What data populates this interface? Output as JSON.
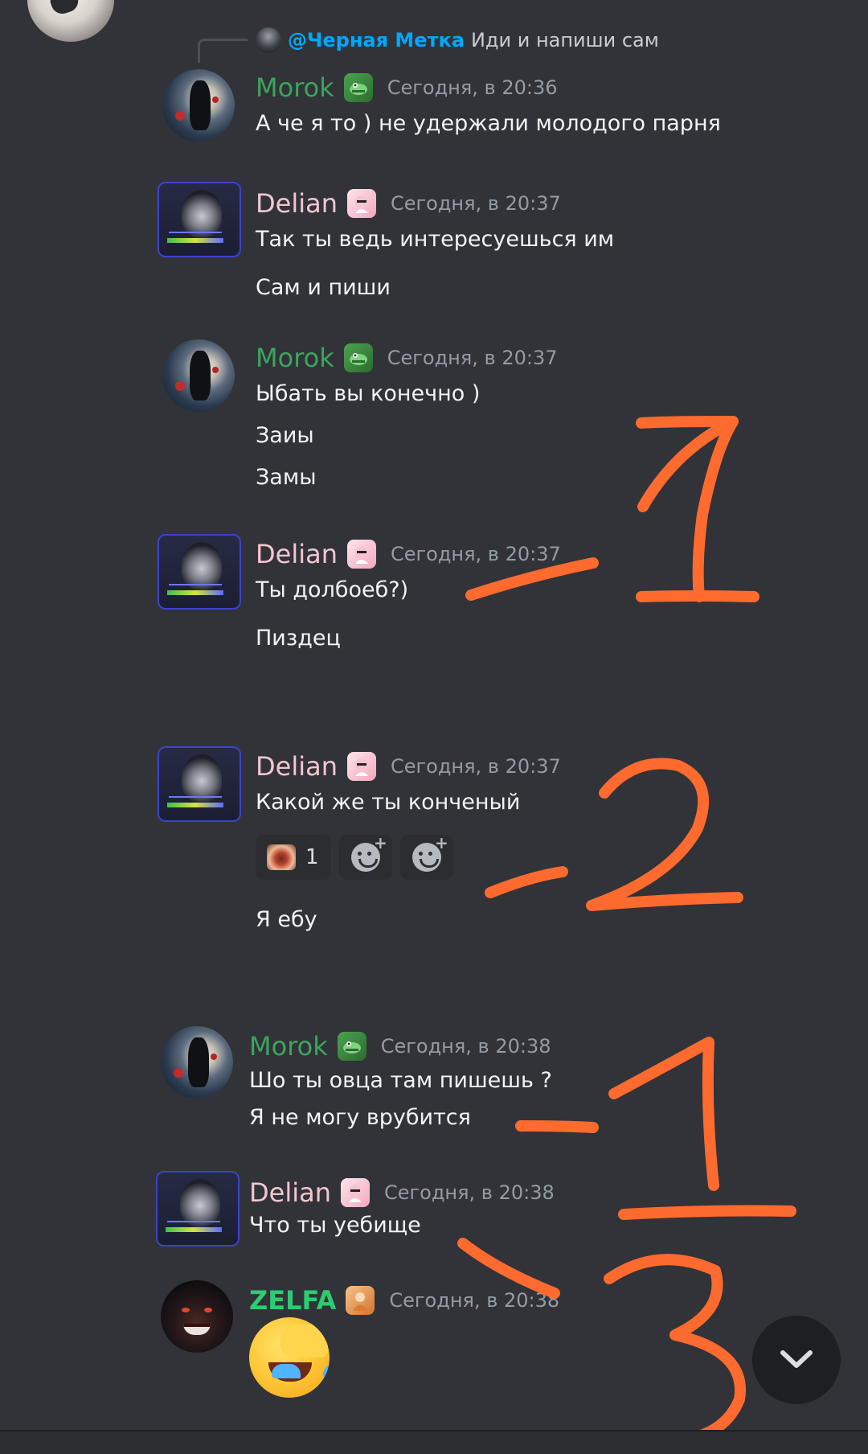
{
  "reply": {
    "mention": "@Черная Метка",
    "text": "Иди и напиши сам"
  },
  "messages": [
    {
      "user": "Morok",
      "role_icon": "crocodile-icon",
      "timestamp": "Сегодня, в 20:36",
      "lines": [
        "А че я то ) не удержали молодого парня"
      ]
    },
    {
      "user": "Delian",
      "role_icon": "pink-character-icon",
      "timestamp": "Сегодня, в 20:37",
      "lines": [
        "Так ты ведь интересуешься им",
        "Сам и пиши"
      ]
    },
    {
      "user": "Morok",
      "role_icon": "crocodile-icon",
      "timestamp": "Сегодня, в 20:37",
      "lines": [
        "Ыбать вы конечно )",
        "Заиы",
        "Замы"
      ]
    },
    {
      "user": "Delian",
      "role_icon": "pink-character-icon",
      "timestamp": "Сегодня, в 20:37",
      "lines": [
        "Ты долбоеб?)",
        "Пиздец"
      ]
    },
    {
      "user": "Delian",
      "role_icon": "pink-character-icon",
      "timestamp": "Сегодня, в 20:37",
      "lines": [
        "Какой же ты конченый",
        "Я ебу"
      ],
      "reaction_count": "1"
    },
    {
      "user": "Morok",
      "role_icon": "crocodile-icon",
      "timestamp": "Сегодня, в 20:38",
      "lines": [
        "Шо ты овца там пишешь ?",
        "Я не могу врубится"
      ]
    },
    {
      "user": "Delian",
      "role_icon": "pink-character-icon",
      "timestamp": "Сегодня, в 20:38",
      "lines": [
        "Что ты уебище"
      ]
    },
    {
      "user": "ZELFA",
      "role_icon": "orange-character-icon",
      "timestamp": "Сегодня, в 20:38",
      "emoji": "rofl-emoji"
    }
  ],
  "annotations": [
    "-1",
    "-2",
    "-1",
    "3"
  ],
  "colors": {
    "background": "#313338",
    "morok": "#3ba55c",
    "delian": "#f2c6cf",
    "zelfa": "#2ecc71",
    "mention": "#00a8fc",
    "timestamp": "#949ba4",
    "annotation": "#ff6a2f"
  },
  "icons": [
    "chevron-down-icon",
    "add-reaction-icon",
    "add-super-reaction-icon"
  ]
}
